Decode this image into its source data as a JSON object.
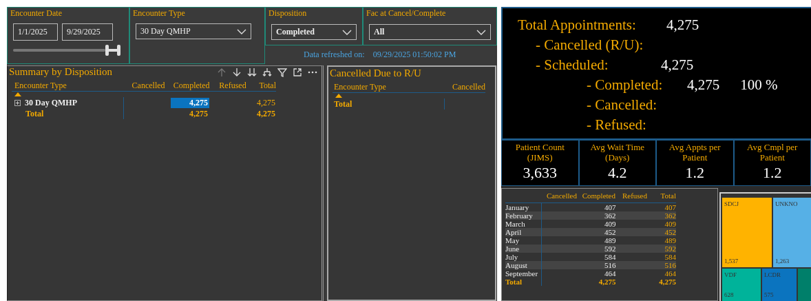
{
  "filters": [
    {
      "kind": "date_range",
      "title": "Encounter Date",
      "start": "1/1/2025",
      "end": "9/29/2025",
      "level": 1
    },
    {
      "kind": "dropdown",
      "title": "Encounter Type",
      "value": "30 Day QMHP"
    },
    {
      "kind": "dropdown",
      "title": "Disposition",
      "value": "Completed"
    },
    {
      "kind": "dropdown",
      "title": "Fac at Cancel/Complete",
      "value": "All"
    }
  ],
  "refresh": {
    "label": "Data refreshed on:",
    "value": "09/29/2025 01:50:02 PM"
  },
  "summary": {
    "title": "Summary by Disposition",
    "toolbar": [
      {
        "kind": "up",
        "disabled": true
      },
      {
        "kind": "down",
        "disabled": false
      },
      {
        "kind": "double_down",
        "disabled": false
      },
      {
        "kind": "fork",
        "disabled": false
      },
      {
        "kind": "filter",
        "disabled": false
      },
      {
        "kind": "focus",
        "disabled": false
      },
      {
        "kind": "more",
        "disabled": false
      }
    ],
    "columns": [
      "Encounter Type",
      "Cancelled",
      "Completed",
      "Refused",
      "Total"
    ],
    "rows": [
      {
        "kind": "data",
        "expandable": true,
        "label": "30 Day QMHP",
        "completed": "4,275",
        "total": "4,275",
        "completed_selected": true
      },
      {
        "kind": "total",
        "expandable": false,
        "label": "Total",
        "completed": "4,275",
        "total": "4,275",
        "completed_selected": false
      }
    ]
  },
  "cancelled_ru": {
    "title": "Cancelled Due to R/U",
    "columns": [
      "Encounter Type",
      "Cancelled"
    ],
    "rows": [
      {
        "kind": "total",
        "label": "Total"
      }
    ]
  },
  "kpi": {
    "items": [
      {
        "label": "Total Appointments:",
        "value": "4,275",
        "children": [
          {
            "label": "- Cancelled (R/U):"
          },
          {
            "label": "- Scheduled:",
            "value": "4,275",
            "children": [
              {
                "label": "- Completed:",
                "value": "4,275",
                "percent": "100 %"
              },
              {
                "label": "- Cancelled:"
              },
              {
                "label": "- Refused:"
              }
            ]
          }
        ]
      }
    ]
  },
  "cards": [
    {
      "label": "Patient Count (JIMS)",
      "value": "3,633"
    },
    {
      "label": "Avg Wait Time (Days)",
      "value": "4.2"
    },
    {
      "label": "Avg Appts per Patient",
      "value": "1.2"
    },
    {
      "label": "Avg Cmpl per Patient",
      "value": "1.2"
    }
  ],
  "monthly": {
    "columns": [
      "Cancelled",
      "Completed",
      "Refused",
      "Total"
    ],
    "rows": [
      {
        "kind": "data",
        "month": "January",
        "completed": "407",
        "total": "407"
      },
      {
        "kind": "data",
        "month": "February",
        "completed": "362",
        "total": "362"
      },
      {
        "kind": "data",
        "month": "March",
        "completed": "409",
        "total": "409"
      },
      {
        "kind": "data",
        "month": "April",
        "completed": "452",
        "total": "452"
      },
      {
        "kind": "data",
        "month": "May",
        "completed": "489",
        "total": "489"
      },
      {
        "kind": "data",
        "month": "June",
        "completed": "592",
        "total": "592"
      },
      {
        "kind": "data",
        "month": "July",
        "completed": "584",
        "total": "584"
      },
      {
        "kind": "data",
        "month": "August",
        "completed": "516",
        "total": "516"
      },
      {
        "kind": "data",
        "month": "September",
        "completed": "464",
        "total": "464"
      },
      {
        "kind": "total",
        "month": "Total",
        "completed": "4,275",
        "total": "4,275"
      }
    ]
  },
  "treemap": {
    "rows": [
      [
        {
          "label": "SDCJ",
          "value": "1,537",
          "color": "#ffb300"
        },
        {
          "label": "UNKNO",
          "value": "1,263",
          "color": "#56b0e6"
        }
      ],
      [
        {
          "label": "VDF",
          "value": "628",
          "color": "#00b39a"
        },
        {
          "label": "LCDR",
          "value": "575",
          "color": "#0b74bf"
        },
        {
          "color": "#007f6a"
        }
      ]
    ]
  }
}
